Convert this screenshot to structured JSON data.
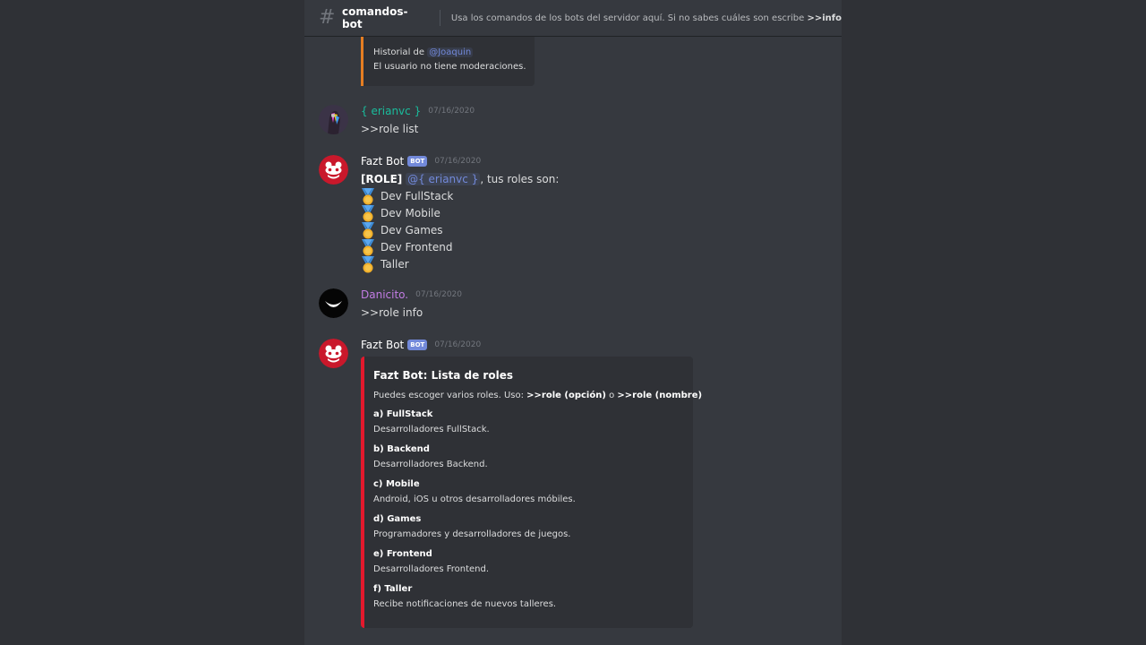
{
  "channel": {
    "name": "comandos-bot",
    "topic_prefix": "Usa los comandos de los bots del servidor aquí. Si no sabes cuáles son escribe ",
    "topic_command": ">>info"
  },
  "top_embed": {
    "line1_prefix": "Historial de ",
    "line1_mention": "@Joaquin",
    "line2": "El usuario no tiene moderaciones."
  },
  "messages": [
    {
      "username": "{ erianvc }",
      "username_color": "#1abc9c",
      "timestamp": "07/16/2020",
      "text": ">>role list"
    },
    {
      "username": "Fazt Bot",
      "bot_tag": "BOT",
      "username_color": "#ffffff",
      "timestamp": "07/16/2020",
      "role_prefix": "[ROLE]",
      "mention": "@{ erianvc }",
      "suffix": ", tus roles son:",
      "roles": [
        "Dev FullStack",
        "Dev Mobile",
        "Dev Games",
        "Dev Frontend",
        "Taller"
      ]
    },
    {
      "username": "Danicito.",
      "username_color": "#c27ce4",
      "timestamp": "07/16/2020",
      "text": ">>role info"
    },
    {
      "username": "Fazt Bot",
      "bot_tag": "BOT",
      "username_color": "#ffffff",
      "timestamp": "07/16/2020"
    }
  ],
  "roles_embed": {
    "title": "Fazt Bot: Lista de roles",
    "desc_prefix": "Puedes escoger varios roles. Uso: ",
    "cmd1": ">>role (opción)",
    "desc_mid": " o ",
    "cmd2": ">>role (nombre)",
    "fields": [
      {
        "name": "a) FullStack",
        "value": "Desarrolladores FullStack."
      },
      {
        "name": "b) Backend",
        "value": "Desarrolladores Backend."
      },
      {
        "name": "c) Mobile",
        "value": "Android, iOS u otros desarrolladores móbiles."
      },
      {
        "name": "d) Games",
        "value": "Programadores y desarrolladores de juegos."
      },
      {
        "name": "e) Frontend",
        "value": "Desarrolladores Frontend."
      },
      {
        "name": "f) Taller",
        "value": "Recibe notificaciones de nuevos talleres."
      }
    ]
  },
  "colors": {
    "background": "#36393f",
    "embed_bg": "#2f3136",
    "embed_accent_top": "#e67e22",
    "embed_accent_roles": "#e3192d",
    "mention": "#7289da",
    "bot_tag": "#7289da"
  },
  "icons": {
    "channel": "hash-icon",
    "role_bullet": "medal-icon"
  }
}
